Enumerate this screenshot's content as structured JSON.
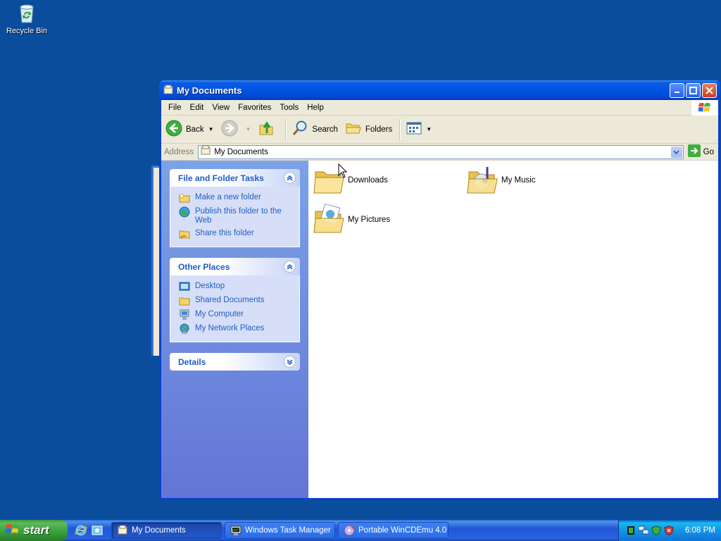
{
  "desktop": {
    "recycle_bin_label": "Recycle Bin"
  },
  "window": {
    "title": "My Documents",
    "menu": [
      "File",
      "Edit",
      "View",
      "Favorites",
      "Tools",
      "Help"
    ],
    "toolbar": {
      "back_label": "Back",
      "search_label": "Search",
      "folders_label": "Folders"
    },
    "address": {
      "label": "Address",
      "value": "My Documents",
      "go_label": "Go"
    },
    "taskpane": {
      "file_folder_tasks": {
        "title": "File and Folder Tasks",
        "items": [
          "Make a new folder",
          "Publish this folder to the Web",
          "Share this folder"
        ]
      },
      "other_places": {
        "title": "Other Places",
        "items": [
          "Desktop",
          "Shared Documents",
          "My Computer",
          "My Network Places"
        ]
      },
      "details": {
        "title": "Details"
      }
    },
    "files": [
      "Downloads",
      "My Music",
      "My Pictures"
    ]
  },
  "taskbar": {
    "start_label": "start",
    "tasks": [
      "My Documents",
      "Windows Task Manager",
      "Portable WinCDEmu 4.0"
    ],
    "active_task": "My Documents",
    "clock": "6:08 PM"
  },
  "colors": {
    "desktop": "#0a4d9c",
    "titlebar": "#0054e3",
    "taskpane_link": "#215dc6",
    "start_green": "#379e37"
  }
}
